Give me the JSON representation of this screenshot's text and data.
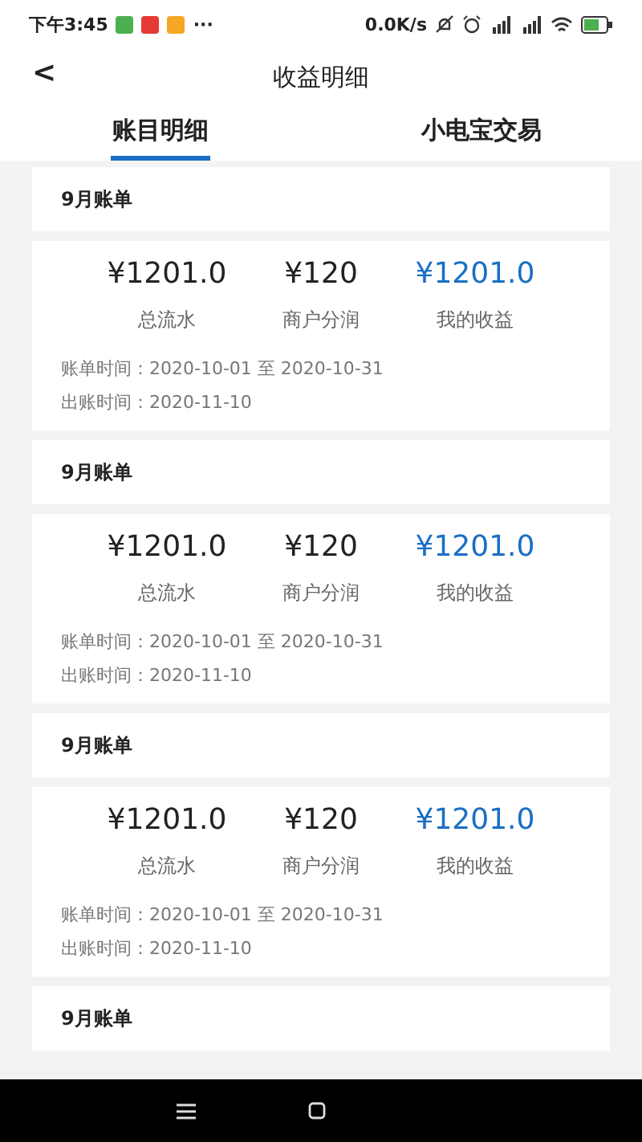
{
  "status_bar": {
    "time": "下午3:45",
    "more": "···",
    "network_speed": "0.0K/s"
  },
  "header": {
    "back": "<",
    "title": "收益明细"
  },
  "tabs": [
    {
      "label": "账目明细",
      "selected": true
    },
    {
      "label": "小电宝交易",
      "selected": false
    }
  ],
  "bills": [
    {
      "title": "9月账单",
      "items": [
        {
          "value": "¥1201.0",
          "label": "总流水",
          "color": "#222222"
        },
        {
          "value": "¥120",
          "label": "商户分润",
          "color": "#222222"
        },
        {
          "value": "¥1201.0",
          "label": "我的收益",
          "color": "#1a6fc4"
        }
      ],
      "bill_period": "账单时间：2020-10-01 至 2020-10-31",
      "issue_date": "出账时间：2020-11-10"
    },
    {
      "title": "9月账单",
      "items": [
        {
          "value": "¥1201.0",
          "label": "总流水",
          "color": "#222222"
        },
        {
          "value": "¥120",
          "label": "商户分润",
          "color": "#222222"
        },
        {
          "value": "¥1201.0",
          "label": "我的收益",
          "color": "#1a6fc4"
        }
      ],
      "bill_period": "账单时间：2020-10-01 至 2020-10-31",
      "issue_date": "出账时间：2020-11-10"
    },
    {
      "title": "9月账单",
      "items": [
        {
          "value": "¥1201.0",
          "label": "总流水",
          "color": "#222222"
        },
        {
          "value": "¥120",
          "label": "商户分润",
          "color": "#222222"
        },
        {
          "value": "¥1201.0",
          "label": "我的收益",
          "color": "#1a6fc4"
        }
      ],
      "bill_period": "账单时间：2020-10-01 至 2020-10-31",
      "issue_date": "出账时间：2020-11-10"
    },
    {
      "title": "9月账单"
    }
  ]
}
